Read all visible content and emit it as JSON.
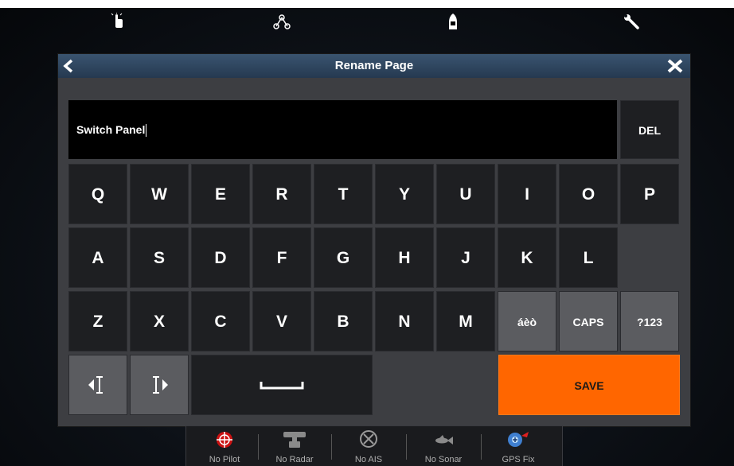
{
  "top_icons": [
    {
      "name": "touch-hand-icon"
    },
    {
      "name": "waypoint-route-icon"
    },
    {
      "name": "boat-icon"
    },
    {
      "name": "wrench-icon"
    }
  ],
  "dialog": {
    "title": "Rename Page",
    "input_value": "Switch Panel"
  },
  "keyboard": {
    "del": "DEL",
    "row1": [
      "Q",
      "W",
      "E",
      "R",
      "T",
      "Y",
      "U",
      "I",
      "O",
      "P"
    ],
    "row2": [
      "A",
      "S",
      "D",
      "F",
      "G",
      "H",
      "J",
      "K",
      "L"
    ],
    "row3": [
      "Z",
      "X",
      "C",
      "V",
      "B",
      "N",
      "M"
    ],
    "accents": "áèò",
    "caps": "CAPS",
    "symbols": "?123",
    "save": "SAVE"
  },
  "status_bar": [
    {
      "label": "No Pilot",
      "icon": "pilot-icon"
    },
    {
      "label": "No Radar",
      "icon": "radar-icon"
    },
    {
      "label": "No AIS",
      "icon": "ais-icon"
    },
    {
      "label": "No Sonar",
      "icon": "sonar-fish-icon"
    },
    {
      "label": "GPS Fix",
      "icon": "gps-satellite-icon"
    }
  ],
  "colors": {
    "accent_save": "#ff6600",
    "titlebar": "#2f4a66",
    "dialog_bg": "#3d3e42",
    "key_bg": "#1e1f22",
    "key_grey": "#5b5c60"
  }
}
